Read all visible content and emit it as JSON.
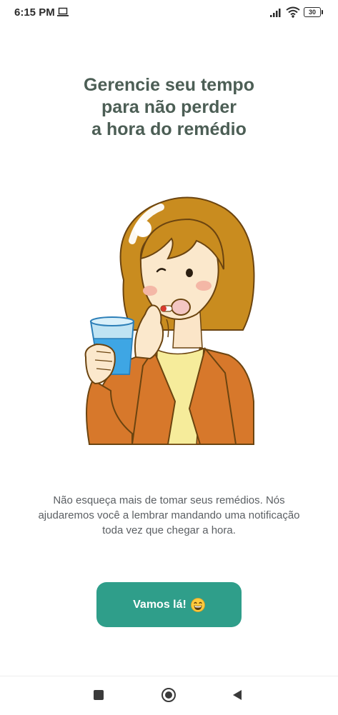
{
  "status_bar": {
    "time": "6:15 PM",
    "battery_level": "30",
    "icons": [
      "laptop-icon",
      "signal-icon",
      "wifi-icon",
      "battery-icon"
    ]
  },
  "onboarding": {
    "headline_lines": [
      "Gerencie seu tempo",
      "para não perder",
      "a hora do remédio"
    ],
    "illustration": "woman-taking-pill-illustration",
    "description_lines": [
      "Não esqueça mais de tomar seus remédios. Nós",
      "ajudaremos você a lembrar mandando uma notificação",
      "toda vez que chegar a hora."
    ],
    "button_label": "Vamos lá!",
    "button_emoji": "grinning-face-icon"
  },
  "colors": {
    "headline": "#4c5e55",
    "button": "#2f9e8a",
    "hair": "#c98c1f",
    "jacket": "#d7782b"
  },
  "nav_bar": {
    "icons": [
      "recents-square-icon",
      "home-circle-icon",
      "back-triangle-icon"
    ]
  }
}
